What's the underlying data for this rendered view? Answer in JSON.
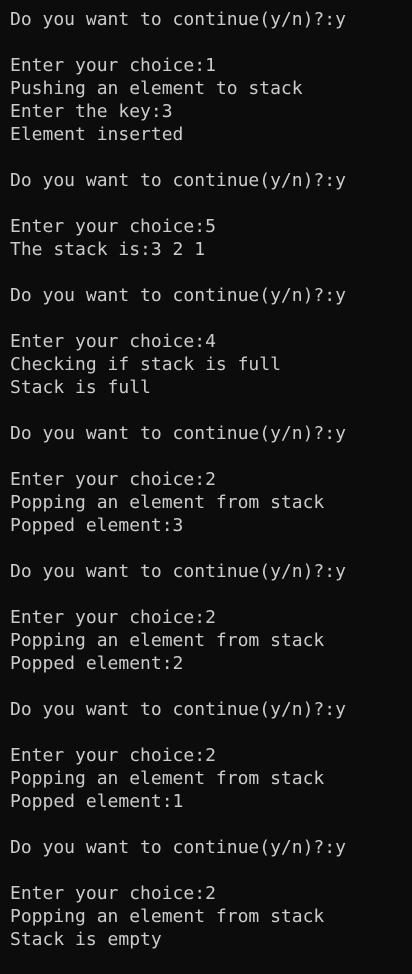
{
  "terminal": {
    "lines": [
      "Do you want to continue(y/n)?:y",
      "",
      "Enter your choice:1",
      "Pushing an element to stack",
      "Enter the key:3",
      "Element inserted",
      "",
      "Do you want to continue(y/n)?:y",
      "",
      "Enter your choice:5",
      "The stack is:3 2 1",
      "",
      "Do you want to continue(y/n)?:y",
      "",
      "Enter your choice:4",
      "Checking if stack is full",
      "Stack is full",
      "",
      "Do you want to continue(y/n)?:y",
      "",
      "Enter your choice:2",
      "Popping an element from stack",
      "Popped element:3",
      "",
      "Do you want to continue(y/n)?:y",
      "",
      "Enter your choice:2",
      "Popping an element from stack",
      "Popped element:2",
      "",
      "Do you want to continue(y/n)?:y",
      "",
      "Enter your choice:2",
      "Popping an element from stack",
      "Popped element:1",
      "",
      "Do you want to continue(y/n)?:y",
      "",
      "Enter your choice:2",
      "Popping an element from stack",
      "Stack is empty"
    ]
  },
  "colors": {
    "background": "#0c0c0c",
    "text": "#cccccc"
  }
}
